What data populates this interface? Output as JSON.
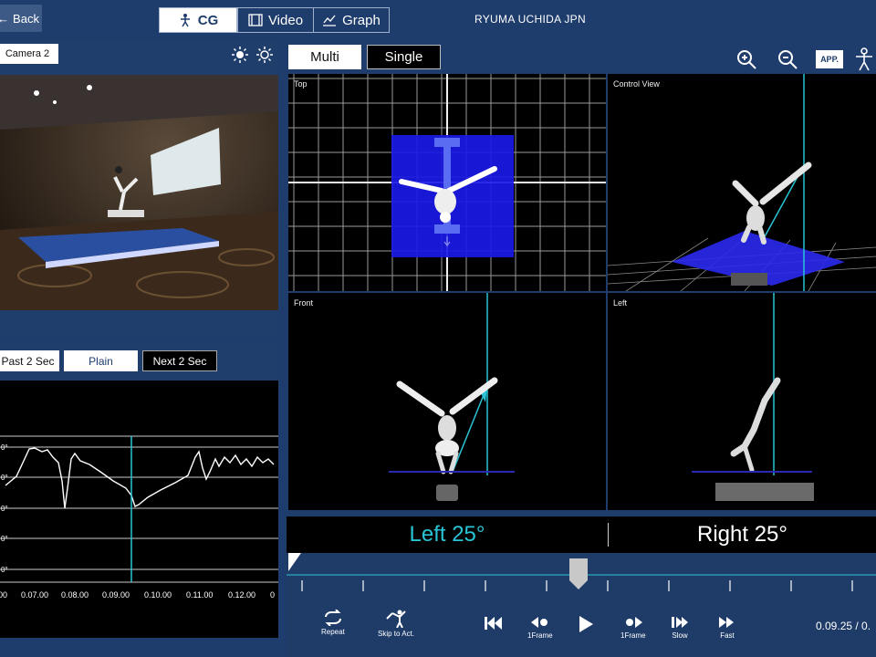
{
  "header": {
    "back_label": "Back",
    "tabs": [
      {
        "label": "CG",
        "icon": "figure-icon",
        "active": true
      },
      {
        "label": "Video",
        "icon": "film-icon",
        "active": false
      },
      {
        "label": "Graph",
        "icon": "graph-icon",
        "active": false
      }
    ],
    "athlete": "RYUMA UCHIDA JPN"
  },
  "camera": {
    "selector_label": "Camera 2"
  },
  "graph": {
    "buttons": [
      "Past 2 Sec",
      "Plain",
      "Next 2 Sec"
    ],
    "active_button": "Plain",
    "x_ticks": [
      "00",
      "0.07.00",
      "0.08.00",
      "0.09.00",
      "0.10.00",
      "0.11.00",
      "0.12.00",
      "0"
    ],
    "y_ticks": [
      "0°",
      "0°",
      "0°",
      "0°",
      "0°"
    ],
    "cursor_x": "0.09.25"
  },
  "modes": [
    "Multi",
    "Single"
  ],
  "active_mode": "Single",
  "toolbar": {
    "zoom_in": "zoom-in-icon",
    "zoom_out": "zoom-out-icon",
    "app_label": "APP.",
    "figure": "figure-icon"
  },
  "views": {
    "top": "Top",
    "control": "Control View",
    "front": "Front",
    "left": "Left"
  },
  "angles": {
    "left": "Left 25°",
    "right": "Right 25°",
    "left_color": "#29c4d6"
  },
  "playback": {
    "repeat": "Repeat",
    "skip": "Skip to Act.",
    "frame_back": "1Frame",
    "frame_fwd": "1Frame",
    "slow": "Slow",
    "fast": "Fast",
    "time": "0.09.25 / 0."
  },
  "colors": {
    "accent": "#29c4d6",
    "panel": "#1e3d6c",
    "platform": "#2020e0"
  }
}
